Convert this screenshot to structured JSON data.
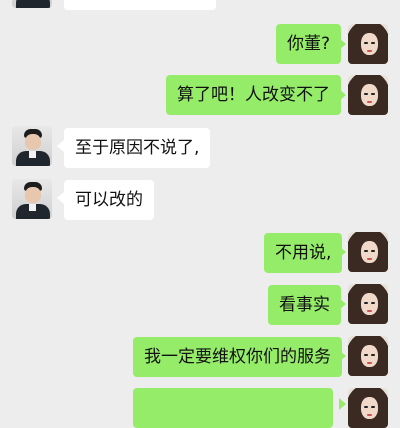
{
  "messages": [
    {
      "side": "in",
      "text": ""
    },
    {
      "side": "out",
      "text": "你董?"
    },
    {
      "side": "out",
      "text": "算了吧！人改变不了"
    },
    {
      "side": "in",
      "text": "至于原因不说了,"
    },
    {
      "side": "in",
      "text": "可以改的"
    },
    {
      "side": "out",
      "text": "不用说,"
    },
    {
      "side": "out",
      "text": "看事实"
    },
    {
      "side": "out",
      "text": "我一定要维权你们的服务"
    },
    {
      "side": "out",
      "text": ""
    }
  ],
  "colors": {
    "background": "#ededed",
    "incoming_bubble": "#ffffff",
    "outgoing_bubble": "#95ec69"
  },
  "icons": {
    "self_avatar": "woman-photo-avatar",
    "contact_avatar": "man-photo-avatar"
  }
}
